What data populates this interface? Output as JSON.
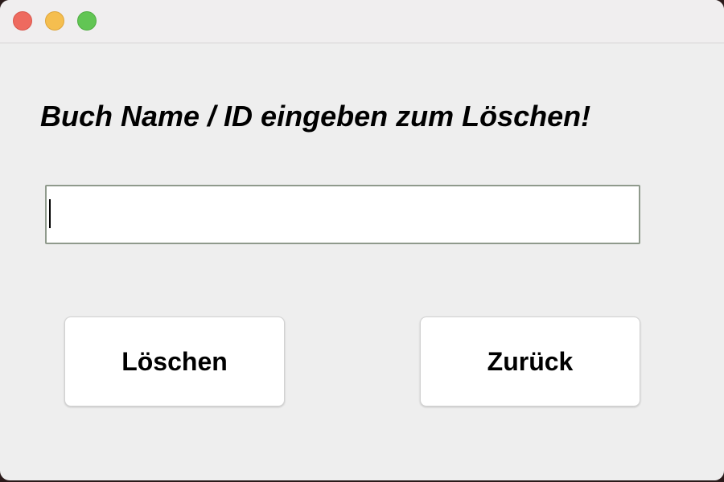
{
  "window": {
    "controls": {
      "close": "close-icon",
      "minimize": "minimize-icon",
      "maximize": "maximize-icon"
    }
  },
  "main": {
    "heading": "Buch Name / ID eingeben zum Löschen!",
    "input": {
      "value": "",
      "placeholder": ""
    },
    "buttons": {
      "delete_label": "Löschen",
      "back_label": "Zurück"
    }
  },
  "colors": {
    "close": "#ee6a5f",
    "minimize": "#f5be4f",
    "maximize": "#62c554",
    "background": "#eeeeee"
  }
}
